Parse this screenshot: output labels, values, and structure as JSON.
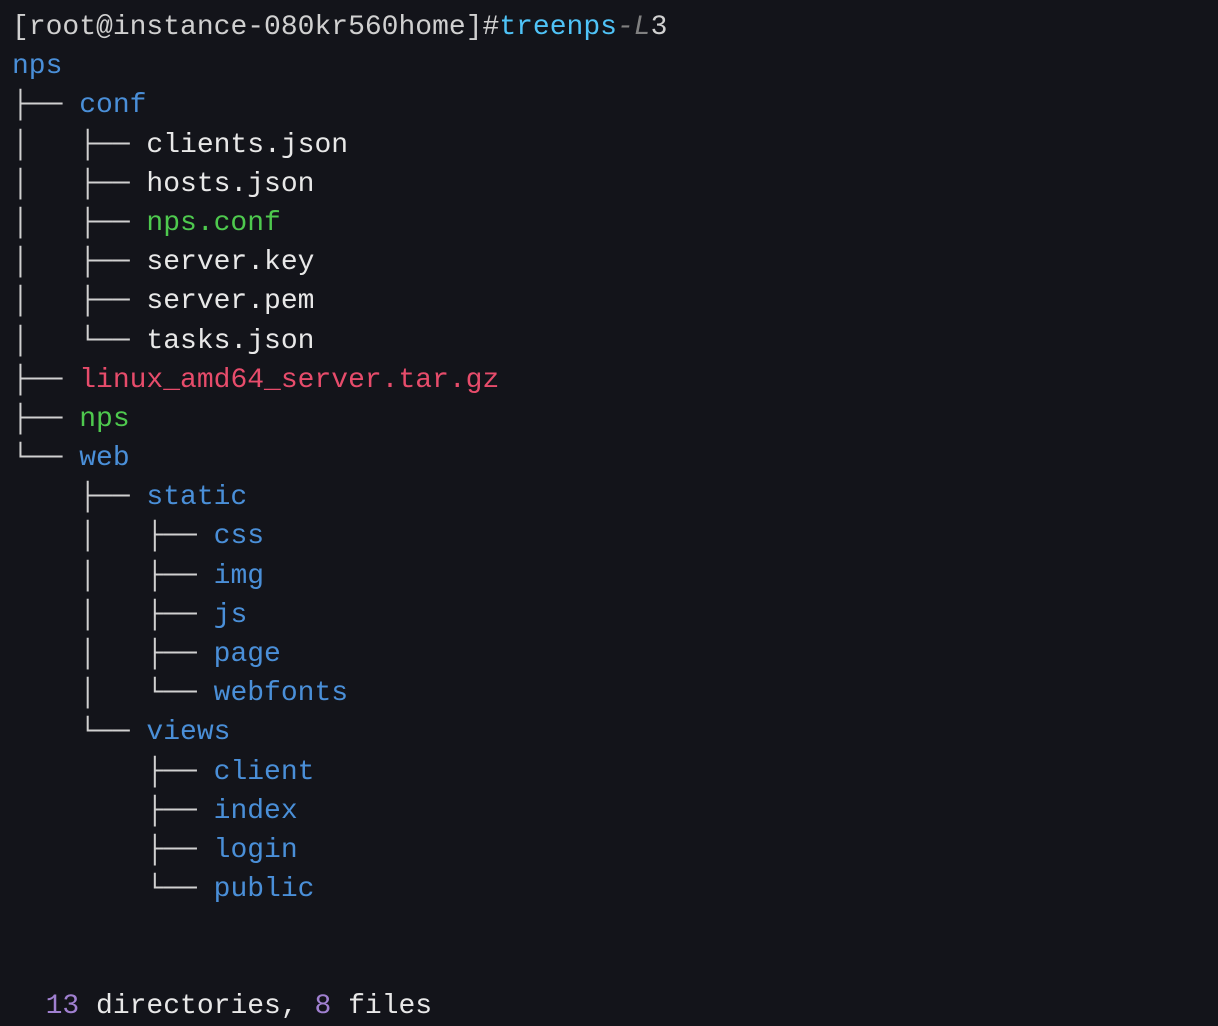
{
  "prompt": {
    "open_bracket": "[",
    "user_host": "root@instance-080kr560",
    "space1": " ",
    "path": "home",
    "close_bracket": "]",
    "hash": "# ",
    "cmd": "tree",
    "space2": " ",
    "arg": "nps",
    "space3": " ",
    "flag": "-L",
    "space4": " ",
    "num": "3"
  },
  "lines": [
    {
      "branch": "",
      "name": "nps",
      "cls": "dir"
    },
    {
      "branch": "├── ",
      "name": "conf",
      "cls": "dir"
    },
    {
      "branch": "│   ├── ",
      "name": "clients.json",
      "cls": "file"
    },
    {
      "branch": "│   ├── ",
      "name": "hosts.json",
      "cls": "file"
    },
    {
      "branch": "│   ├── ",
      "name": "nps.conf",
      "cls": "exec"
    },
    {
      "branch": "│   ├── ",
      "name": "server.key",
      "cls": "file"
    },
    {
      "branch": "│   ├── ",
      "name": "server.pem",
      "cls": "file"
    },
    {
      "branch": "│   └── ",
      "name": "tasks.json",
      "cls": "file"
    },
    {
      "branch": "├── ",
      "name": "linux_amd64_server.tar.gz",
      "cls": "archive"
    },
    {
      "branch": "├── ",
      "name": "nps",
      "cls": "exec"
    },
    {
      "branch": "└── ",
      "name": "web",
      "cls": "dir"
    },
    {
      "branch": "    ├── ",
      "name": "static",
      "cls": "dir"
    },
    {
      "branch": "    │   ├── ",
      "name": "css",
      "cls": "dir"
    },
    {
      "branch": "    │   ├── ",
      "name": "img",
      "cls": "dir"
    },
    {
      "branch": "    │   ├── ",
      "name": "js",
      "cls": "dir"
    },
    {
      "branch": "    │   ├── ",
      "name": "page",
      "cls": "dir"
    },
    {
      "branch": "    │   └── ",
      "name": "webfonts",
      "cls": "dir"
    },
    {
      "branch": "    └── ",
      "name": "views",
      "cls": "dir"
    },
    {
      "branch": "        ├── ",
      "name": "client",
      "cls": "dir"
    },
    {
      "branch": "        ├── ",
      "name": "index",
      "cls": "dir"
    },
    {
      "branch": "        ├── ",
      "name": "login",
      "cls": "dir"
    },
    {
      "branch": "        └── ",
      "name": "public",
      "cls": "dir"
    }
  ],
  "summary": {
    "dirs_num": "13",
    "dirs_label": " directories, ",
    "files_num": "8",
    "files_label": " files"
  }
}
